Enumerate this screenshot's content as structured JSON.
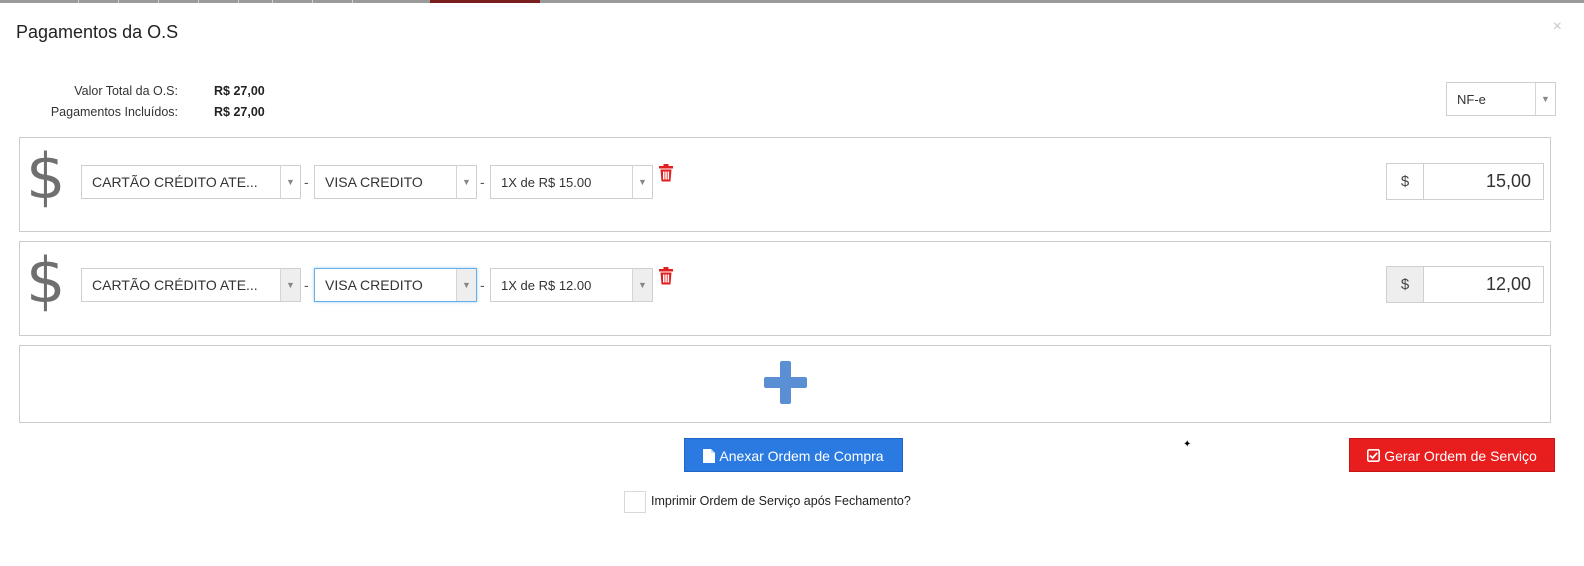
{
  "modal": {
    "title": "Pagamentos da O.S",
    "close_label": "×"
  },
  "summary": {
    "total_label": "Valor Total da O.S:",
    "total_value": "R$ 27,00",
    "included_label": "Pagamentos Incluídos:",
    "included_value": "R$ 27,00"
  },
  "invoice_type": {
    "selected": "NF-e"
  },
  "payments": [
    {
      "method": "CARTÃO CRÉDITO ATE...",
      "brand": "VISA CREDITO",
      "installments": "1X de R$ 15.00",
      "currency_symbol": "$",
      "amount": "15,00"
    },
    {
      "method": "CARTÃO CRÉDITO ATE...",
      "brand": "VISA CREDITO",
      "installments": "1X de R$ 12.00",
      "currency_symbol": "$",
      "amount": "12,00"
    }
  ],
  "separator": "-",
  "dollar_glyph": "$",
  "buttons": {
    "attach_order": "Anexar Ordem de Compra",
    "generate_order": "Gerar Ordem de Serviço"
  },
  "print_after_close_label": "Imprimir Ordem de Serviço após Fechamento?",
  "icons": {
    "dollar": "dollar-icon",
    "trash": "trash-icon",
    "add": "plus-icon",
    "file": "file-icon",
    "check": "check-square-icon"
  },
  "colors": {
    "primary": "#2a7ae2",
    "danger": "#e81e1e",
    "add_plus": "#5b8fd4",
    "trash": "#e02020"
  }
}
